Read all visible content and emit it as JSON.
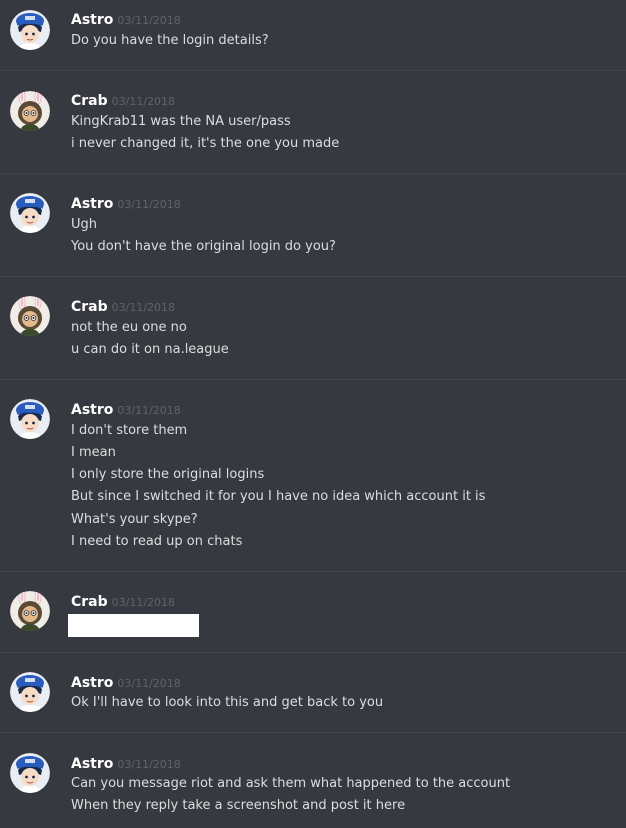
{
  "messages": [
    {
      "author": "Astro",
      "timestamp": "03/11/2018",
      "avatar": "astro-avatar-icon",
      "lines": [
        "Do you have the login details?"
      ]
    },
    {
      "author": "Crab",
      "timestamp": "03/11/2018",
      "avatar": "crab-avatar-icon",
      "lines": [
        "KingKrab11 was the NA user/pass",
        "i never changed it, it's the one you made"
      ]
    },
    {
      "author": "Astro",
      "timestamp": "03/11/2018",
      "avatar": "astro-avatar-icon",
      "lines": [
        "Ugh",
        "You don't have the original login do you?"
      ]
    },
    {
      "author": "Crab",
      "timestamp": "03/11/2018",
      "avatar": "crab-avatar-icon",
      "lines": [
        "not the eu one no",
        "u can do it on na.league"
      ]
    },
    {
      "author": "Astro",
      "timestamp": "03/11/2018",
      "avatar": "astro-avatar-icon",
      "lines": [
        "I don't store them",
        "I mean",
        "I only store the original logins",
        "But since I switched it for you I have no idea which account it is",
        "What's your skype?",
        "I need to read up on chats"
      ]
    },
    {
      "author": "Crab",
      "timestamp": "03/11/2018",
      "avatar": "crab-avatar-icon",
      "lines": [],
      "redacted": true
    },
    {
      "author": "Astro",
      "timestamp": "03/11/2018",
      "avatar": "astro-avatar-icon",
      "lines": [
        "Ok I'll have to look into this and get back to you"
      ]
    },
    {
      "author": "Astro",
      "timestamp": "03/11/2018",
      "avatar": "astro-avatar-icon",
      "lines": [
        "Can you message riot and ask them what happened to the account",
        "When they reply take a screenshot and post it here"
      ]
    }
  ]
}
